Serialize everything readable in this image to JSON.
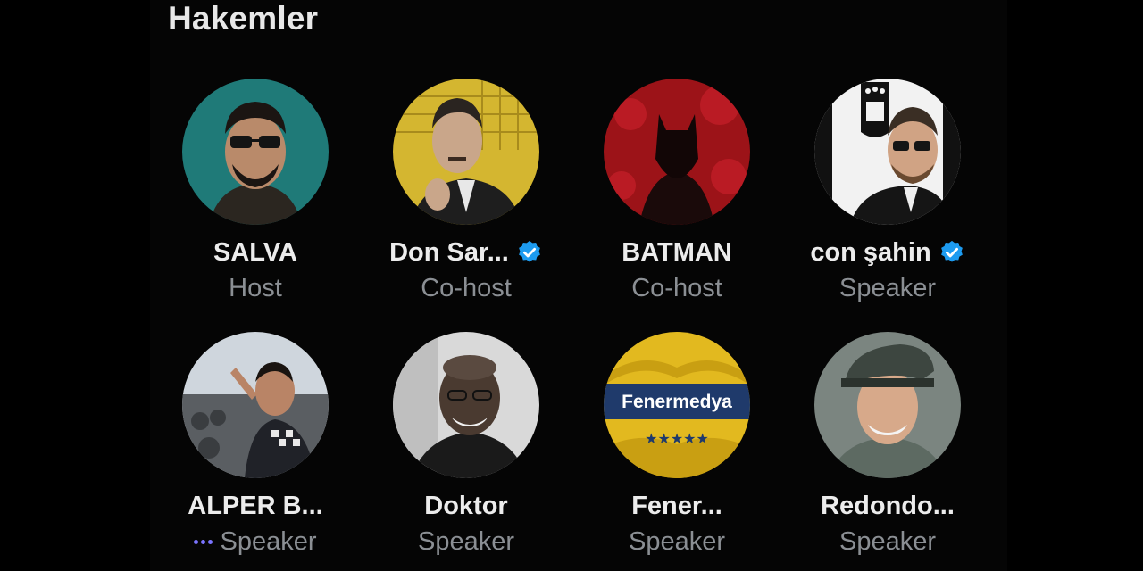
{
  "section": {
    "title": "Hakemler"
  },
  "participants": [
    {
      "name": "SALVA",
      "role": "Host",
      "verified": false,
      "speaking": false
    },
    {
      "name": "Don Sar...",
      "role": "Co-host",
      "verified": true,
      "speaking": false
    },
    {
      "name": "BATMAN",
      "role": "Co-host",
      "verified": false,
      "speaking": false
    },
    {
      "name": "con şahin",
      "role": "Speaker",
      "verified": true,
      "speaking": false
    },
    {
      "name": "ALPER B...",
      "role": "Speaker",
      "verified": false,
      "speaking": true
    },
    {
      "name": "Doktor",
      "role": "Speaker",
      "verified": false,
      "speaking": false
    },
    {
      "name": "Fener...",
      "role": "Speaker",
      "verified": false,
      "speaking": false
    },
    {
      "name": "Redondo...",
      "role": "Speaker",
      "verified": false,
      "speaking": false
    }
  ],
  "logo_text": {
    "brand": "Fenermedya",
    "stars": "★★★★★"
  },
  "colors": {
    "background": "#000000",
    "name_text": "#ececec",
    "role_text": "#8b8f94",
    "verified_badge": "#1d9bf0",
    "speaking_dots": "#7b74ff"
  }
}
